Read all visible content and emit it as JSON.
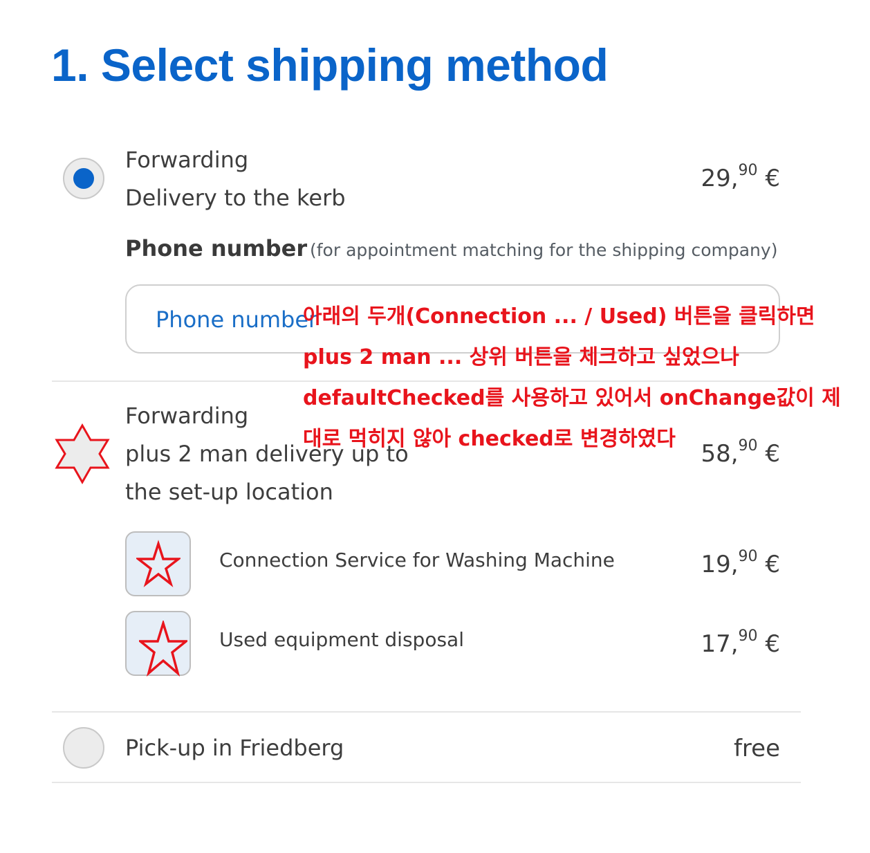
{
  "title": "1. Select shipping method",
  "options": [
    {
      "name": "Forwarding",
      "description": "Delivery to the kerb",
      "price_main": "29,",
      "price_cents": "90",
      "price_currency": " €",
      "selected": true
    },
    {
      "name": "Forwarding",
      "description_line1": "plus 2 man delivery up to",
      "description_line2": "the set-up location",
      "price_main": "58,",
      "price_cents": "90",
      "price_currency": " €",
      "selected": false
    },
    {
      "name": "Pick-up in Friedberg",
      "price": "free",
      "selected": false
    }
  ],
  "phone": {
    "label": "Phone number",
    "hint": "(for appointment matching for the shipping company)",
    "placeholder": "Phone number"
  },
  "extras": [
    {
      "label": "Connection Service for  Washing Machine",
      "price_main": "19,",
      "price_cents": "90",
      "price_currency": " €"
    },
    {
      "label": "Used equipment disposal",
      "price_main": "17,",
      "price_cents": "90",
      "price_currency": " €"
    }
  ],
  "annotation": {
    "line1": "아래의 두개(Connection ... / Used) 버튼을 클릭하면",
    "line2": "plus 2 man ... 상위 버튼을 체크하고 싶었으나",
    "line3": "defaultChecked를 사용하고 있어서 onChange값이 제",
    "line4": "대로 먹히지 않아 checked로 변경하였다"
  },
  "colors": {
    "accent": "#0a64c9",
    "annotation": "#e8141c",
    "checkbox_bg": "#e6eef7"
  }
}
